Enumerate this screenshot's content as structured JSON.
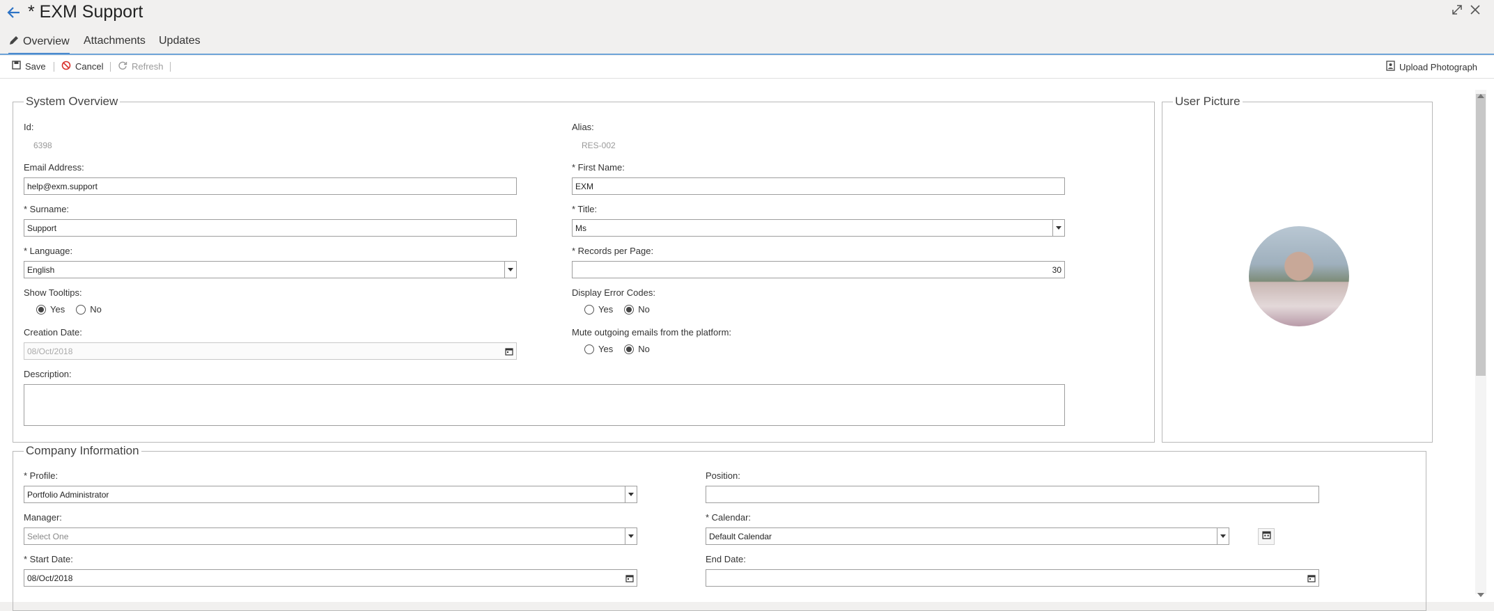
{
  "header": {
    "title": "* EXM Support",
    "back_icon": "arrow-left-icon",
    "expand_icon": "expand-icon",
    "close_icon": "close-icon"
  },
  "tabs": [
    {
      "label": "Overview",
      "icon": "pencil-icon",
      "active": true
    },
    {
      "label": "Attachments"
    },
    {
      "label": "Updates"
    }
  ],
  "toolbar": {
    "save_label": "Save",
    "cancel_label": "Cancel",
    "refresh_label": "Refresh",
    "upload_label": "Upload Photograph"
  },
  "system_overview": {
    "legend": "System Overview",
    "id_label": "Id:",
    "id_value": "6398",
    "alias_label": "Alias:",
    "alias_value": "RES-002",
    "email_label": "Email Address:",
    "email_value": "help@exm.support",
    "first_name_label": "* First Name:",
    "first_name_value": "EXM",
    "surname_label": "* Surname:",
    "surname_value": "Support",
    "title_label": "* Title:",
    "title_value": "Ms",
    "language_label": "* Language:",
    "language_value": "English",
    "records_label": "* Records per Page:",
    "records_value": "30",
    "tooltips_label": "Show Tooltips:",
    "error_codes_label": "Display Error Codes:",
    "mute_label": "Mute outgoing emails from the platform:",
    "yes_label": "Yes",
    "no_label": "No",
    "show_tooltips": "Yes",
    "display_error_codes": "No",
    "mute_outgoing": "No",
    "creation_date_label": "Creation Date:",
    "creation_date_value": "08/Oct/2018",
    "description_label": "Description:",
    "description_value": ""
  },
  "user_picture": {
    "legend": "User Picture"
  },
  "company_info": {
    "legend": "Company Information",
    "profile_label": "* Profile:",
    "profile_value": "Portfolio Administrator",
    "position_label": "Position:",
    "position_value": "",
    "manager_label": "Manager:",
    "manager_placeholder": "Select One",
    "calendar_label": "* Calendar:",
    "calendar_value": "Default Calendar",
    "start_date_label": "* Start Date:",
    "start_date_value": "08/Oct/2018",
    "end_date_label": "End Date:",
    "end_date_value": ""
  },
  "colors": {
    "accent": "#2d73c5",
    "cancel_red": "#d9302c"
  }
}
